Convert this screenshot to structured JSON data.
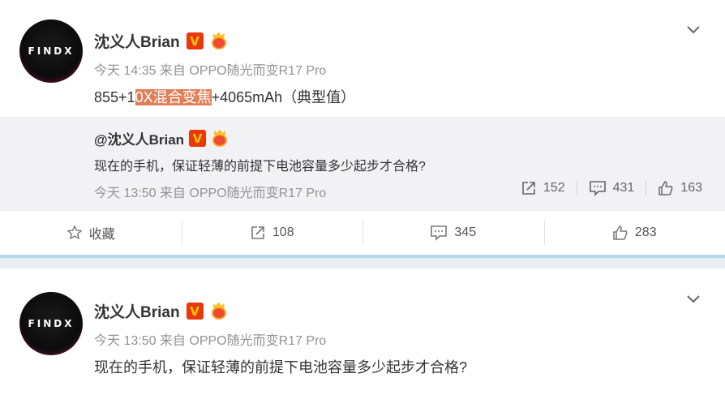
{
  "posts": [
    {
      "avatar_text": "FINDX",
      "username": "沈义人Brian",
      "verified_badge": "V",
      "meta": "今天 14:35 来自 OPPO随光而变R17 Pro",
      "content_prefix": "855+1",
      "content_highlight": "0X混合变焦",
      "content_suffix": "+4065mAh（典型值）",
      "repost": {
        "username": "@沈义人Brian",
        "text": "现在的手机，保证轻薄的前提下电池容量多少起步才合格?",
        "meta": "今天 13:50 来自 OPPO随光而变R17 Pro",
        "reposts": "152",
        "comments": "431",
        "likes": "163"
      },
      "actions": {
        "favorite_label": "收藏",
        "repost_count": "108",
        "comment_count": "345",
        "like_count": "283"
      }
    },
    {
      "avatar_text": "FINDX",
      "username": "沈义人Brian",
      "verified_badge": "V",
      "meta": "今天 13:50 来自 OPPO随光而变R17 Pro",
      "content": "现在的手机，保证轻薄的前提下电池容量多少起步才合格?"
    }
  ],
  "colors": {
    "highlight": "#e07f58",
    "verified": "#e8380d",
    "divider_band": "#b3d9ea"
  }
}
